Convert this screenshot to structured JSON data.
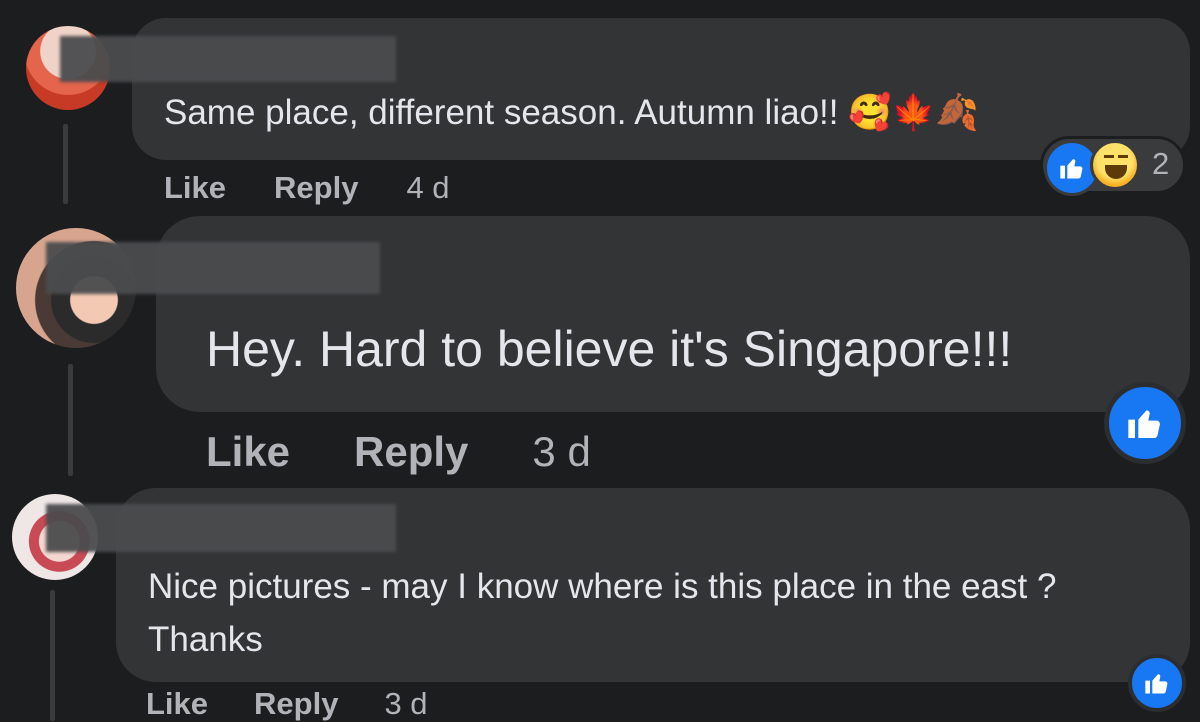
{
  "comments": [
    {
      "text": "Same place, different season. Autumn liao!! 🥰🍁🍂",
      "actions": {
        "like": "Like",
        "reply": "Reply",
        "time": "4 d"
      },
      "reactions": {
        "types": [
          "like-icon",
          "haha-icon"
        ],
        "count": "2"
      }
    },
    {
      "text": "Hey. Hard to believe it's Singapore!!!",
      "actions": {
        "like": "Like",
        "reply": "Reply",
        "time": "3 d"
      },
      "reactions": {
        "types": [
          "like-icon"
        ]
      }
    },
    {
      "text": "Nice pictures - may I know where is this place in the east ? Thanks",
      "actions": {
        "like": "Like",
        "reply": "Reply",
        "time": "3 d"
      },
      "reactions": {
        "types": [
          "like-icon"
        ]
      }
    }
  ],
  "colors": {
    "background": "#1c1d1f",
    "bubble": "#323436",
    "text": "#e4e6eb",
    "muted": "#b0b3b8",
    "like_blue": "#1877f2"
  }
}
